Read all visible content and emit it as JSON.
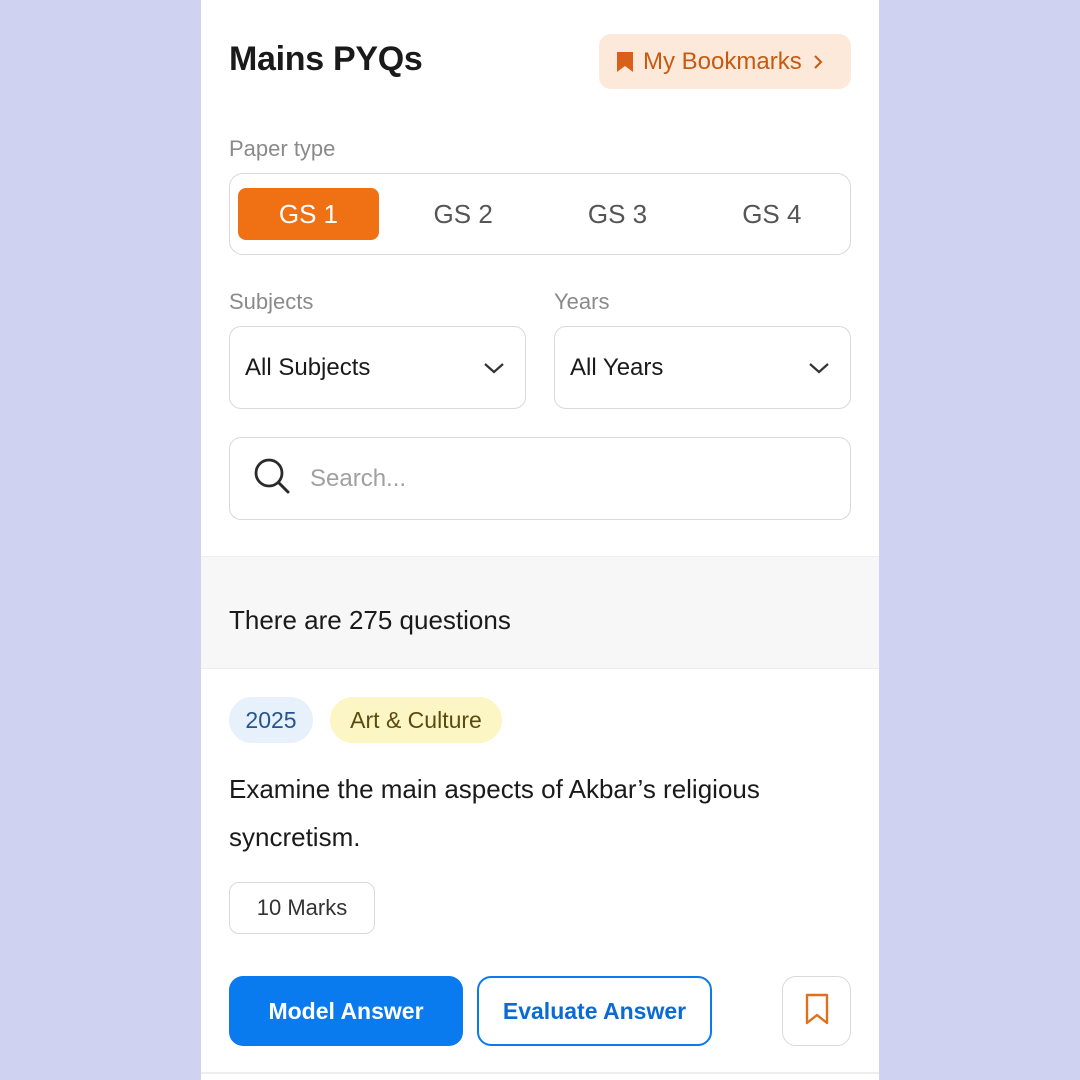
{
  "header": {
    "title": "Mains PYQs",
    "bookmarks_label": "My Bookmarks",
    "accent": "#f07014"
  },
  "paper_type": {
    "label": "Paper type",
    "options": [
      "GS 1",
      "GS 2",
      "GS 3",
      "GS 4"
    ],
    "selected": "GS 1"
  },
  "filters": {
    "subjects_label": "Subjects",
    "subjects_value": "All Subjects",
    "years_label": "Years",
    "years_value": "All Years"
  },
  "search": {
    "placeholder": "Search..."
  },
  "results": {
    "count_text": "There are 275 questions"
  },
  "question_card": {
    "year": "2025",
    "subject": "Art & Culture",
    "text": "Examine the main aspects of Akbar’s religious syncretism.",
    "marks": "10 Marks",
    "model_answer_label": "Model Answer",
    "evaluate_answer_label": "Evaluate Answer",
    "primary_color": "#0a7bef"
  }
}
